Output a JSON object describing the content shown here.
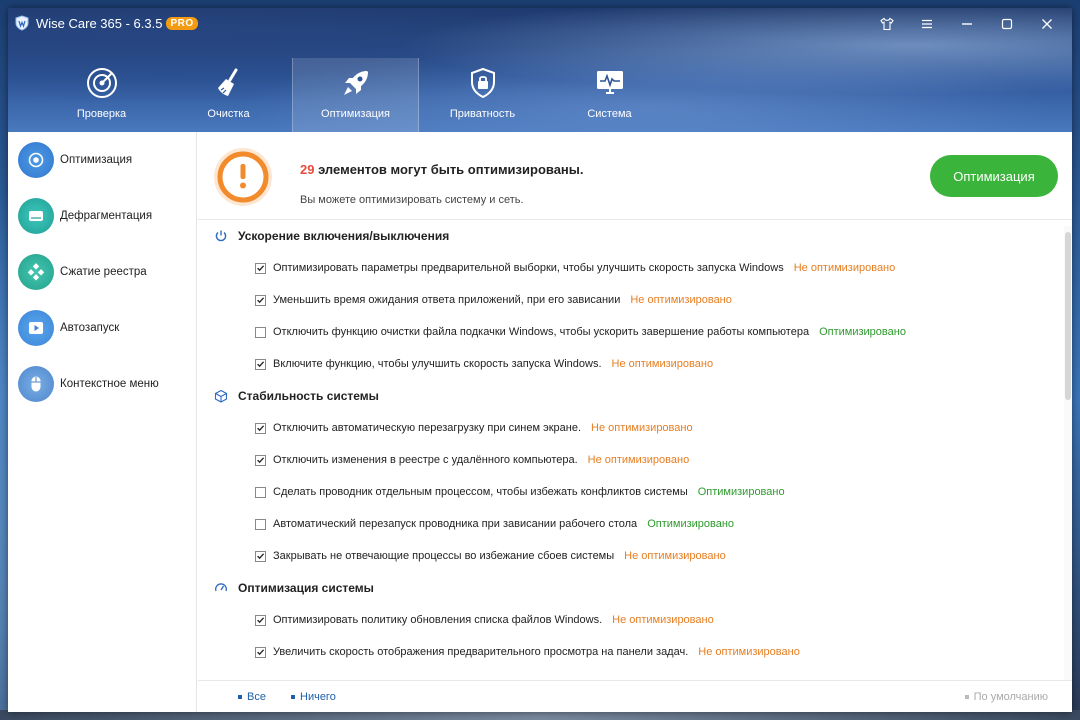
{
  "app": {
    "title": "Wise Care 365 - 6.3.5",
    "badge": "PRO",
    "accent": "#3ab43a"
  },
  "window_controls": [
    {
      "name": "skin-icon"
    },
    {
      "name": "menu-icon"
    },
    {
      "name": "minimize-icon"
    },
    {
      "name": "maximize-icon"
    },
    {
      "name": "close-icon"
    }
  ],
  "nav": {
    "tabs": [
      {
        "label": "Проверка",
        "icon": "radar-icon",
        "active": false
      },
      {
        "label": "Очистка",
        "icon": "broom-icon",
        "active": false
      },
      {
        "label": "Оптимизация",
        "icon": "rocket-icon",
        "active": true
      },
      {
        "label": "Приватность",
        "icon": "lock-shield-icon",
        "active": false
      },
      {
        "label": "Система",
        "icon": "monitor-icon",
        "active": false
      }
    ]
  },
  "sidebar": {
    "items": [
      {
        "label": "Оптимизация",
        "icon": "gear-icon",
        "color": "#3a86d8"
      },
      {
        "label": "Дефрагментация",
        "icon": "disk-icon",
        "color": "#26b3a8"
      },
      {
        "label": "Сжатие реестра",
        "icon": "registry-icon",
        "color": "#2fb4a0"
      },
      {
        "label": "Автозапуск",
        "icon": "play-icon",
        "color": "#3a86d8"
      },
      {
        "label": "Контекстное меню",
        "icon": "mouse-icon",
        "color": "#5a8fd0"
      }
    ]
  },
  "summary": {
    "count": "29",
    "title_rest": " элементов могут быть оптимизированы.",
    "subtitle": "Вы можете оптимизировать систему и сеть.",
    "button": "Оптимизация",
    "count_color": "#e74c3c"
  },
  "status": {
    "not_optimized": "Не оптимизировано",
    "not_optimized_color": "#e67e22",
    "optimized": "Оптимизировано",
    "optimized_color": "#2e9a2e"
  },
  "sections": [
    {
      "title": "Ускорение включения/выключения",
      "icon": "power-icon",
      "rows": [
        {
          "text": "Оптимизировать параметры предварительной выборки, чтобы улучшить скорость запуска Windows",
          "checked": true,
          "status": "Не оптимизировано"
        },
        {
          "text": "Уменьшить время ожидания ответа приложений, при его зависании",
          "checked": true,
          "status": "Не оптимизировано"
        },
        {
          "text": "Отключить функцию очистки файла подкачки Windows, чтобы ускорить завершение работы компьютера",
          "checked": false,
          "status": "Оптимизировано"
        },
        {
          "text": "Включите функцию, чтобы улучшить скорость запуска Windows.",
          "checked": true,
          "status": "Не оптимизировано"
        }
      ]
    },
    {
      "title": "Стабильность системы",
      "icon": "cube-icon",
      "rows": [
        {
          "text": "Отключить автоматическую перезагрузку при синем экране.",
          "checked": true,
          "status": "Не оптимизировано"
        },
        {
          "text": "Отключить изменения в реестре с удалённого компьютера.",
          "checked": true,
          "status": "Не оптимизировано"
        },
        {
          "text": "Сделать проводник отдельным процессом, чтобы избежать конфликтов системы",
          "checked": false,
          "status": "Оптимизировано"
        },
        {
          "text": "Автоматический перезапуск проводника при зависании рабочего стола",
          "checked": false,
          "status": "Оптимизировано"
        },
        {
          "text": "Закрывать не отвечающие процессы во избежание сбоев системы",
          "checked": true,
          "status": "Не оптимизировано"
        }
      ]
    },
    {
      "title": "Оптимизация системы",
      "icon": "speedometer-icon",
      "rows": [
        {
          "text": "Оптимизировать политику обновления списка файлов Windows.",
          "checked": true,
          "status": "Не оптимизировано"
        },
        {
          "text": "Увеличить скорость отображения предварительного просмотра на панели задач.",
          "checked": true,
          "status": "Не оптимизировано"
        }
      ]
    }
  ],
  "footer": {
    "select_all": "Все",
    "select_none": "Ничего",
    "defaults": "По умолчанию"
  }
}
